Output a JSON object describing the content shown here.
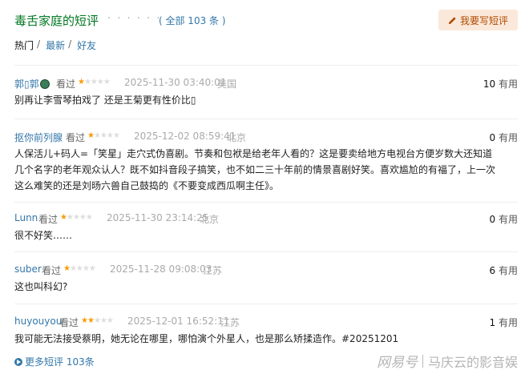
{
  "header": {
    "title": "毒舌家庭的短评",
    "dots": "· · · · · ·",
    "count": "( 全部 103 条 )",
    "write_label": "我要写短评"
  },
  "filters": {
    "hot": "热门",
    "latest": "最新",
    "friends": "好友",
    "sep": "/"
  },
  "comments": [
    {
      "user": "郭▯郭",
      "seen": "看过",
      "stars": 1,
      "time": "2025-11-30 03:40:01",
      "location": "美国",
      "useful_count": "10",
      "useful_label": "有用",
      "text": "别再让李雪琴拍戏了 还是王菊更有性价比▯"
    },
    {
      "user": "抠你前列腺",
      "seen": "看过",
      "stars": 1,
      "time": "2025-12-02 08:59:41",
      "location": "北京",
      "useful_count": "0",
      "useful_label": "有用",
      "text": "人保活儿+码人=「笑星」走穴式伪喜剧。节奏和包袱是给老年人看的？这是要卖给地方电视台方便岁数大还知道几个名字的老年观众认人？既不如抖音段子搞笑，也不如二三十年前的情景喜剧好笑。喜欢尴尬的有福了，上一次这么难笑的还是刘旸六兽自己鼓捣的《不要变成西瓜啊主任》。"
    },
    {
      "user": "Lunn",
      "seen": "看过",
      "stars": 1,
      "time": "2025-11-30 23:14:25",
      "location": "北京",
      "useful_count": "0",
      "useful_label": "有用",
      "text": "很不好笑……"
    },
    {
      "user": "suber",
      "seen": "看过",
      "stars": 1,
      "time": "2025-11-28 09:08:03",
      "location": "江苏",
      "useful_count": "6",
      "useful_label": "有用",
      "text": "这也叫科幻?"
    },
    {
      "user": "huyouyou",
      "seen": "看过",
      "stars": 2,
      "time": "2025-12-01 16:52:11",
      "location": "江苏",
      "useful_count": "1",
      "useful_label": "有用",
      "text": "我可能无法接受蔡明，她无论在哪里，哪怕演个外星人，也是那么矫揉造作。#20251201"
    }
  ],
  "more": {
    "label": "更多短评 103条"
  },
  "watermark": {
    "brand": "网易号",
    "author": "马庆云的影音娱"
  },
  "colors": {
    "link": "#3377aa",
    "title": "#007722",
    "star": "#f99b01",
    "button_bg": "#fae9da"
  }
}
